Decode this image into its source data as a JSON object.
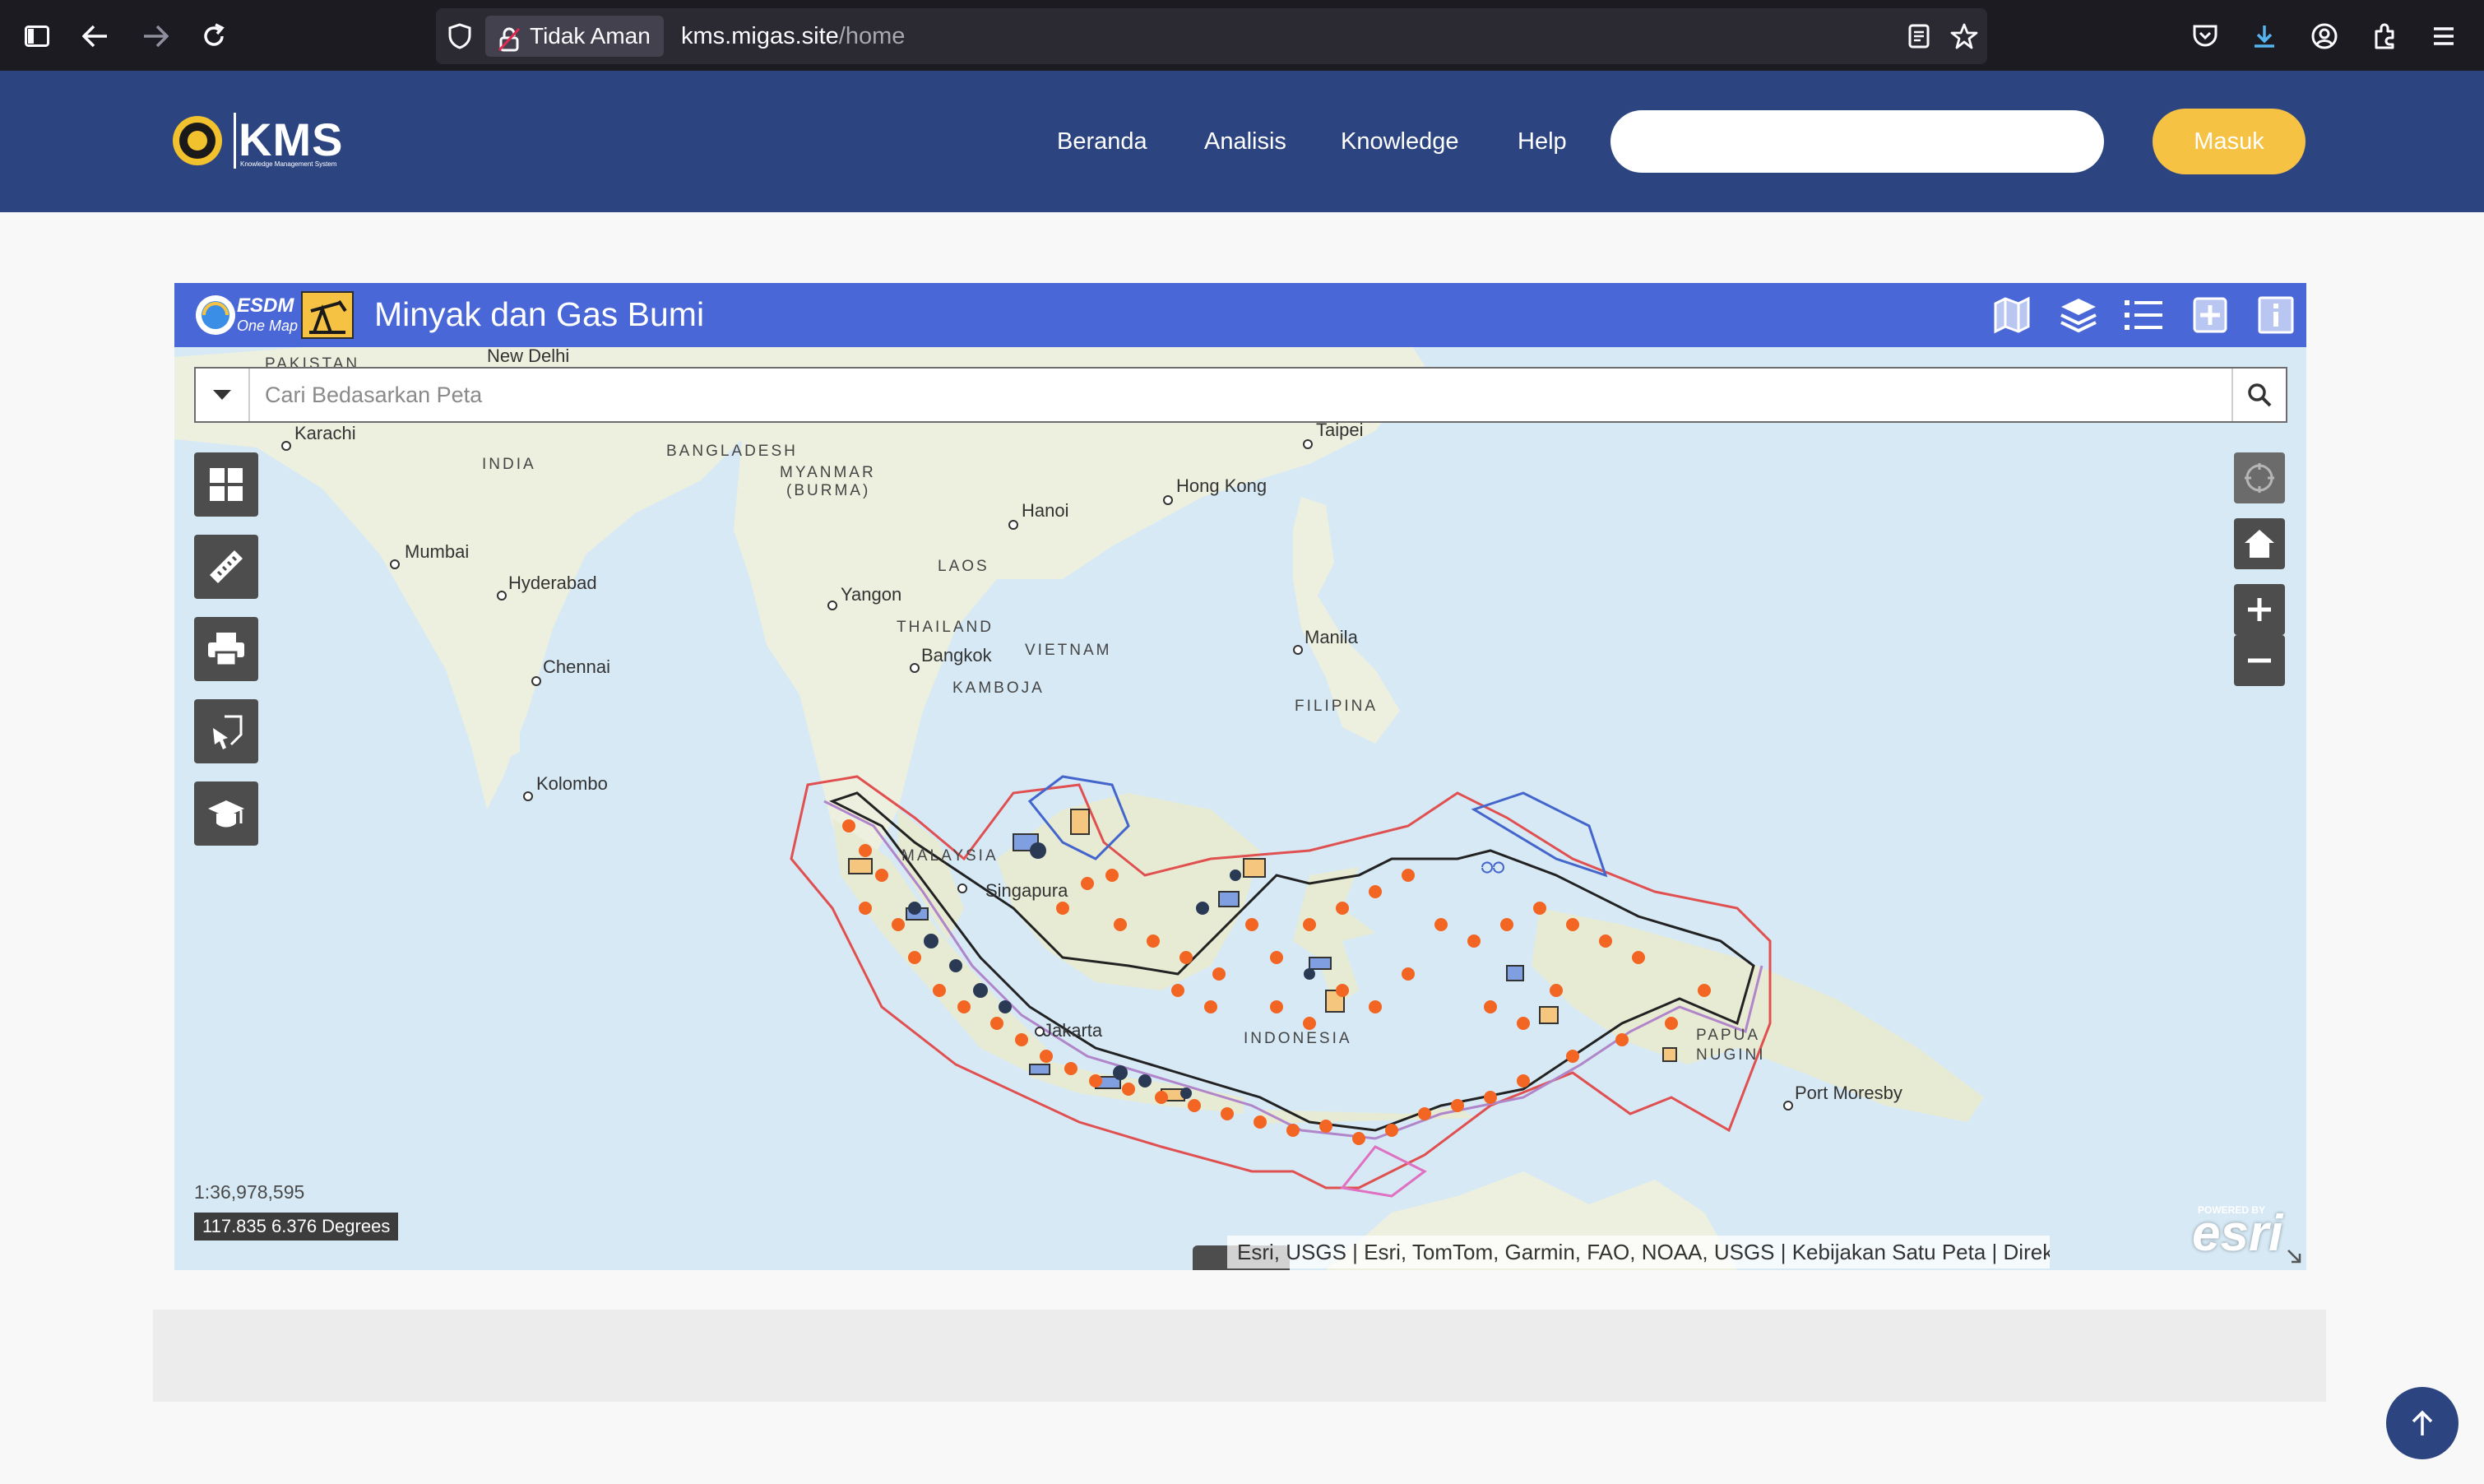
{
  "browser": {
    "security_label": "Tidak Aman",
    "url_domain": "kms.migas.site",
    "url_path": "/home"
  },
  "site": {
    "logo_text": "KMS",
    "logo_subtext": "Knowledge Management System",
    "nav": [
      "Beranda",
      "Analisis",
      "Knowledge",
      "Help"
    ],
    "search_value": "",
    "login_label": "Masuk"
  },
  "map": {
    "title": "Minyak dan Gas Bumi",
    "brand_text": "ESDM",
    "brand_subtext": "One Map",
    "search_placeholder": "Cari Bedasarkan Peta",
    "toolbar_icons": [
      "basemap-icon",
      "layers-icon",
      "legend-list-icon",
      "add-data-icon",
      "info-icon"
    ],
    "tool_icons": [
      "grid-icon",
      "measure-ruler-icon",
      "print-icon",
      "draw-icon",
      "education-icon"
    ],
    "scale": "1:36,978,595",
    "coordinates": "117.835 6.376 Degrees",
    "attribution": "Esri, USGS | Esri, TomTom, Garmin, FAO, NOAA, USGS | Kebijakan Satu Peta | Direktorat Pembin…",
    "esri_powered": "POWERED BY",
    "esri_logo": "esri",
    "labels": {
      "pakistan": "PAKISTAN",
      "new_delhi": "New Delhi",
      "karachi": "Karachi",
      "india": "INDIA",
      "bangladesh": "BANGLADESH",
      "myanmar": "MYANMAR",
      "burma": "(BURMA)",
      "taipei": "Taipei",
      "hong_kong": "Hong Kong",
      "hanoi": "Hanoi",
      "mumbai": "Mumbai",
      "hyderabad": "Hyderabad",
      "laos": "LAOS",
      "yangon": "Yangon",
      "thailand": "THAILAND",
      "bangkok": "Bangkok",
      "vietnam": "VIETNAM",
      "kamboja": "KAMBOJA",
      "manila": "Manila",
      "chennai": "Chennai",
      "filipina": "FILIPINA",
      "kolombo": "Kolombo",
      "malaysia": "MALAYSIA",
      "singapura": "Singapura",
      "jakarta": "Jakarta",
      "indonesia": "INDONESIA",
      "papua": "PAPUA",
      "nugini": "NUGINI",
      "port_moresby": "Port Moresby"
    }
  },
  "colors": {
    "header_bg": "#2c4581",
    "map_titlebar": "#4a67d8",
    "login_btn": "#f6c244",
    "ocean": "#d6e9f5",
    "land": "#eef0e0",
    "boundary_red": "#e05050",
    "marker_orange": "#f26522"
  }
}
